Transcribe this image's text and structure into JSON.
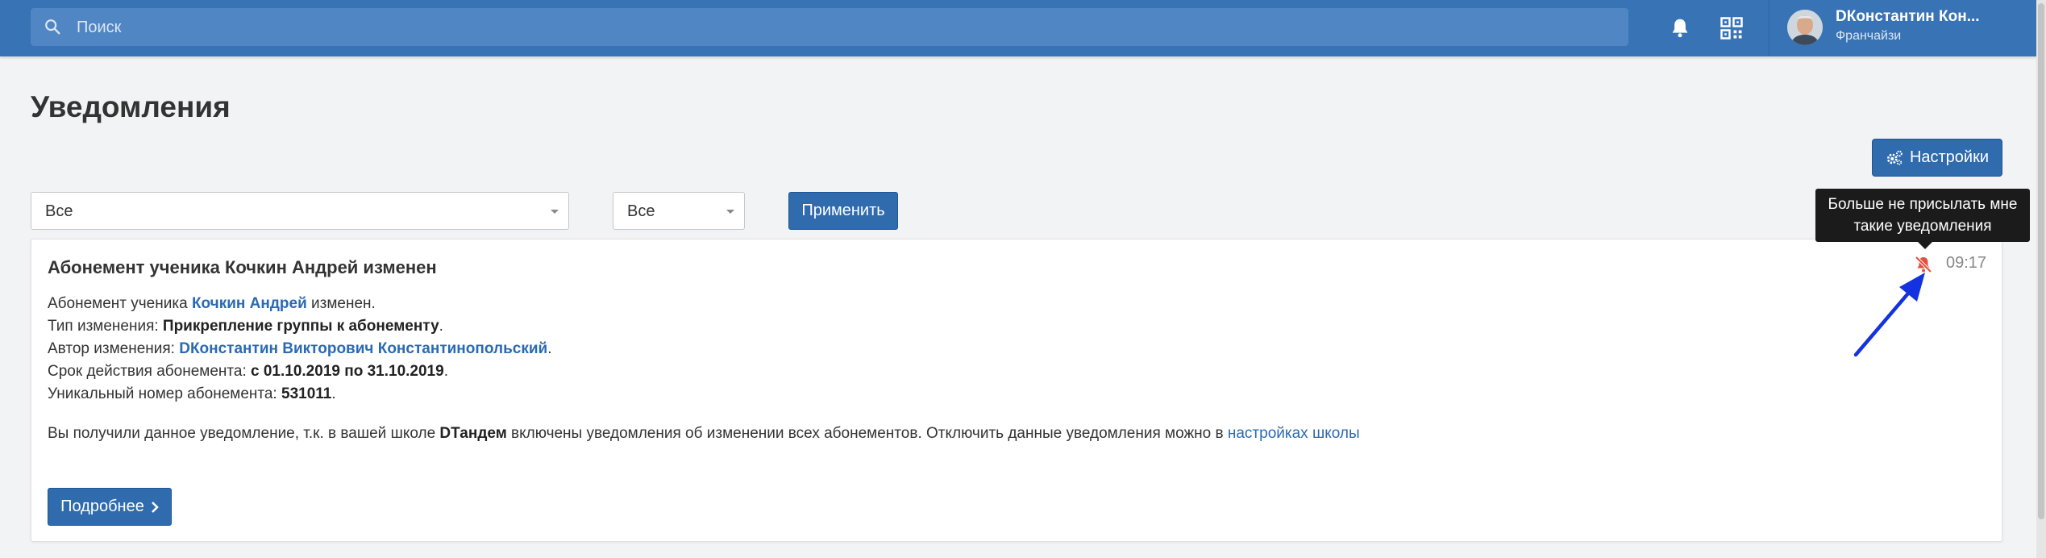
{
  "header": {
    "search": {
      "placeholder": "Поиск"
    },
    "icons": [
      "bell-icon",
      "qr-code-icon"
    ],
    "user": {
      "name": "DКонстантин Кон...",
      "role": "Франчайзи"
    }
  },
  "page": {
    "title": "Уведомления",
    "settings_label": "Настройки",
    "filter1_value": "Все",
    "filter2_value": "Все",
    "apply_label": "Применить"
  },
  "notification": {
    "title": "Абонемент ученика Кочкин Андрей изменен",
    "time": "09:17",
    "line1": {
      "prefix": "Абонемент ученика ",
      "link": "Кочкин Андрей",
      "suffix": " изменен."
    },
    "line2": {
      "label": "Тип изменения: ",
      "value": "Прикрепление группы к абонементу",
      "suffix": "."
    },
    "line3": {
      "label": "Автор изменения: ",
      "link": "DКонстантин Викторович Константинопольский",
      "suffix": "."
    },
    "line4": {
      "label": "Срок действия абонемента: ",
      "value": "с 01.10.2019 по 31.10.2019",
      "suffix": "."
    },
    "line5": {
      "label": "Уникальный номер абонемента: ",
      "value": "531011",
      "suffix": "."
    },
    "note": {
      "prefix": "Вы получили данное уведомление, т.к. в вашей школе ",
      "school": "DТандем",
      "middle": " включены уведомления об изменении всех абонементов. Отключить данные уведомления можно в ",
      "link": "настройках школы"
    },
    "more_label": "Подробнее",
    "mute_tooltip_line1": "Больше не присылать мне",
    "mute_tooltip_line2": "такие уведомления"
  },
  "colors": {
    "topbar": "#3773b5",
    "primary_button": "#2f6bad",
    "link": "#2a6ab3",
    "mute_icon": "#e0523d",
    "annotation_arrow": "#1433e0"
  }
}
